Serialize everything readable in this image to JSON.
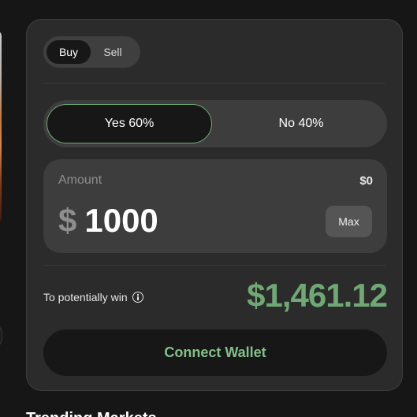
{
  "trade": {
    "side_tabs": {
      "buy": "Buy",
      "sell": "Sell",
      "active": "buy"
    },
    "outcomes": {
      "yes": "Yes 60%",
      "no": "No 40%",
      "selected": "yes"
    },
    "amount": {
      "label": "Amount",
      "balance": "$0",
      "currency": "$",
      "value": "1000",
      "max_label": "Max"
    },
    "potential_win": {
      "label": "To potentially win",
      "value": "$1,461.12"
    },
    "connect_wallet_label": "Connect Wallet"
  },
  "section": {
    "heading": "Trending Markets"
  },
  "icons": {
    "info": "info-icon"
  },
  "colors": {
    "accent_green": "#6fa874",
    "button_text_green": "#83c08a"
  }
}
